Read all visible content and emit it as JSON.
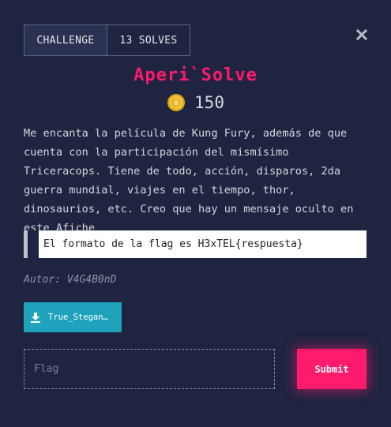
{
  "tabs": {
    "challenge_label": "CHALLENGE",
    "solves_label": "13 SOLVES"
  },
  "challenge": {
    "title": "Aperi`Solve",
    "points": "150",
    "description": "Me encanta la película de Kung Fury, además de que cuenta con la participación del mismísimo Triceracops. Tiene de todo, acción, disparos, 2da guerra mundial, viajes en el tiempo, thor, dinosaurios, etc. Creo que hay un mensaje oculto en este Afiche",
    "flag_format": "El formato de la flag es H3xTEL{respuesta}",
    "author": "Autor: V4G4B0nD"
  },
  "file": {
    "label": "True_Stegan…",
    "icon": "download-icon"
  },
  "form": {
    "flag_placeholder": "Flag",
    "submit_label": "Submit"
  },
  "colors": {
    "background": "#1f2440",
    "accent": "#ff1a6b",
    "file_button": "#1fa3bd"
  }
}
